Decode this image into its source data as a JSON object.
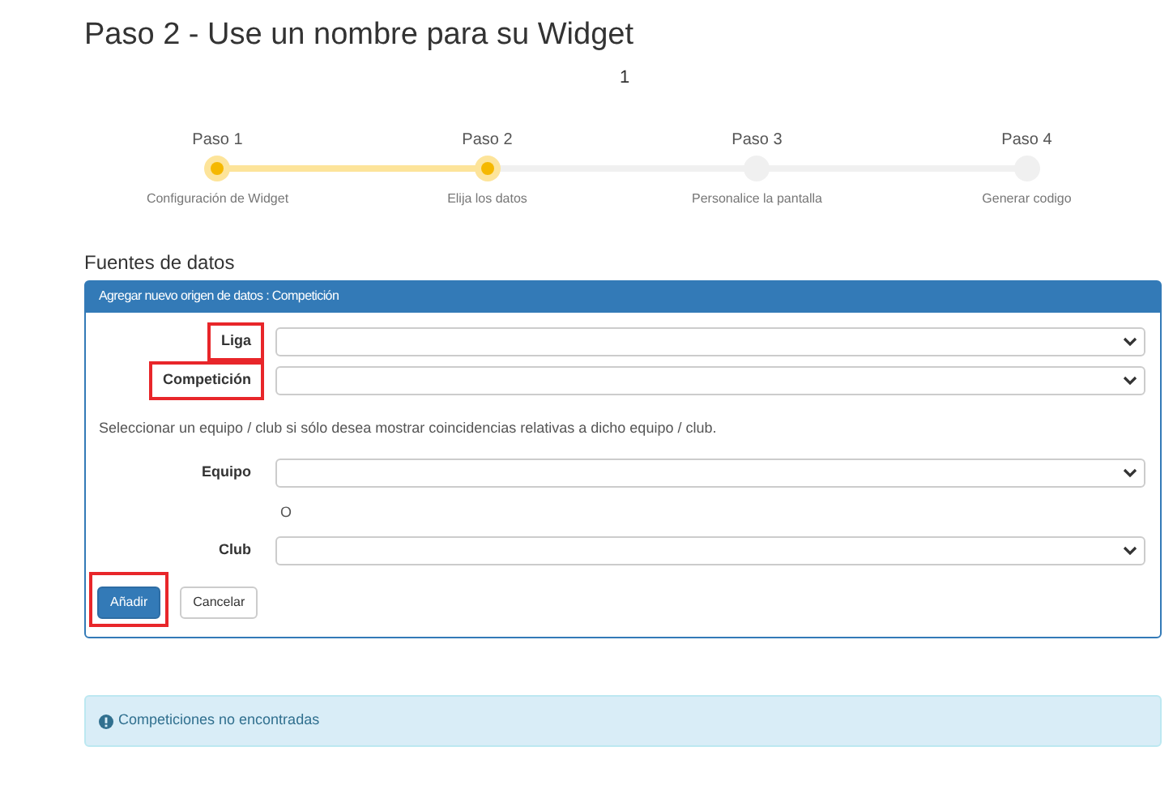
{
  "title": "Paso 2 - Use un nombre para su Widget",
  "counter": "1",
  "steps": [
    {
      "label": "Paso 1",
      "caption": "Configuración de Widget",
      "completed": true
    },
    {
      "label": "Paso 2",
      "caption": "Elija los datos",
      "completed": true
    },
    {
      "label": "Paso 3",
      "caption": "Personalice la pantalla",
      "completed": false
    },
    {
      "label": "Paso 4",
      "caption": "Generar codigo",
      "completed": false
    }
  ],
  "section_title": "Fuentes de datos",
  "panel": {
    "header": "Agregar nuevo origen de datos : Competición",
    "rows": [
      {
        "kind": "select",
        "label": "Liga",
        "highlighted": true
      },
      {
        "kind": "select",
        "label": "Competición",
        "highlighted": true
      },
      {
        "kind": "help",
        "text": "Seleccionar un equipo / club si sólo desea mostrar coincidencias relativas a dicho equipo / club."
      },
      {
        "kind": "select",
        "label": "Equipo",
        "highlighted": false
      },
      {
        "kind": "note",
        "text": "O"
      },
      {
        "kind": "select",
        "label": "Club",
        "highlighted": false
      }
    ],
    "buttons": [
      {
        "label": "Añadir",
        "kind": "primary",
        "highlighted": true
      },
      {
        "label": "Cancelar",
        "kind": "default",
        "highlighted": false
      }
    ]
  },
  "alert": "Competiciones no encontradas"
}
